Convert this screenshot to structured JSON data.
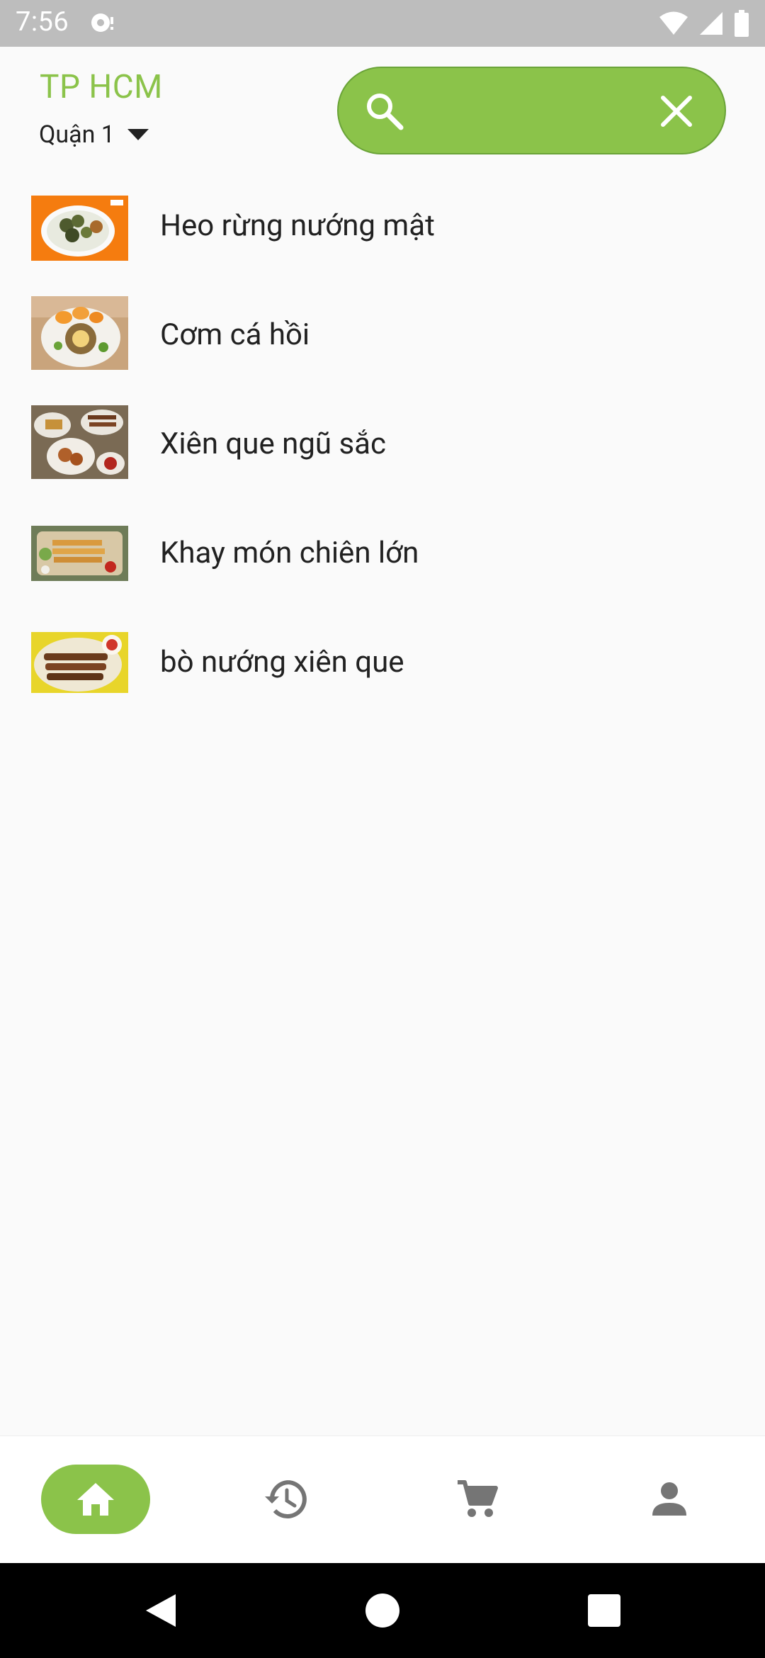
{
  "status_bar": {
    "time": "7:56"
  },
  "header": {
    "city": "TP HCM",
    "district": "Quận 1",
    "search": {
      "placeholder": "",
      "value": ""
    }
  },
  "items": [
    {
      "name": "Heo rừng nướng mật"
    },
    {
      "name": "Cơm cá hồi"
    },
    {
      "name": "Xiên que ngũ sắc"
    },
    {
      "name": "Khay món chiên lớn"
    },
    {
      "name": "bò nướng xiên que"
    }
  ],
  "bottom_nav": [
    {
      "icon": "home-icon",
      "active": true
    },
    {
      "icon": "history-icon",
      "active": false
    },
    {
      "icon": "cart-icon",
      "active": false
    },
    {
      "icon": "person-icon",
      "active": false
    }
  ],
  "system_nav": [
    "back-icon",
    "home-circle-icon",
    "recents-icon"
  ],
  "colors": {
    "accent": "#8bc34a",
    "status_bar": "#bdbdbd",
    "icon_grey": "#757575"
  }
}
